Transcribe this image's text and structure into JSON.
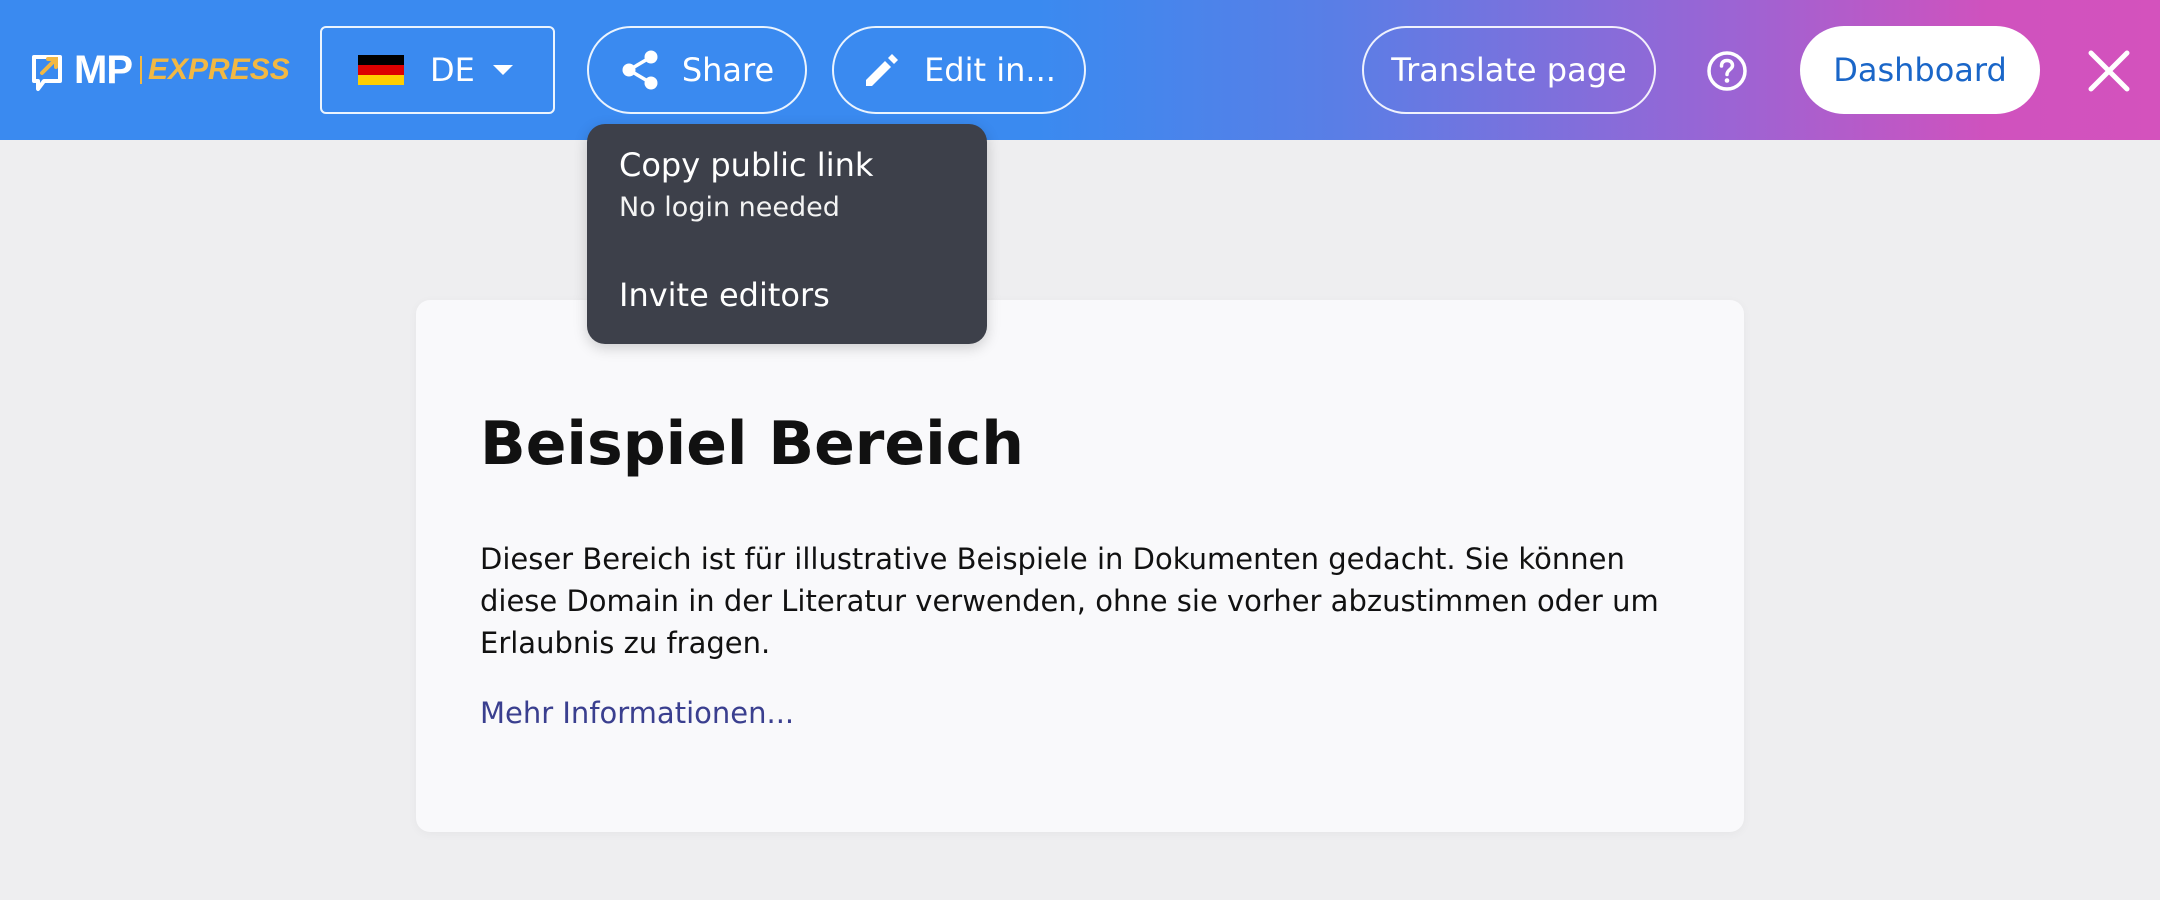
{
  "topbar": {
    "logo": {
      "mp": "MP",
      "express": "EXPRESS"
    },
    "language": {
      "code": "DE",
      "flag": "germany-flag"
    },
    "share_label": "Share",
    "edit_label": "Edit in...",
    "translate_label": "Translate page",
    "dashboard_label": "Dashboard",
    "icons": {
      "share": "share-icon",
      "edit": "pencil-icon",
      "help": "help-icon",
      "close": "close-icon"
    },
    "colors": {
      "gradient_start": "#3a8af0",
      "gradient_end": "#d452bd",
      "dashboard_text": "#1a66c8",
      "logo_accent": "#f2b843"
    }
  },
  "share_menu": {
    "items": [
      {
        "label": "Copy public link",
        "sublabel": "No login needed"
      },
      {
        "label": "Invite editors"
      }
    ],
    "background": "#3d404a"
  },
  "content": {
    "title": "Beispiel Bereich",
    "text": "Dieser Bereich ist für illustrative Beispiele in Dokumenten gedacht. Sie können diese Domain in der Literatur verwenden, ohne sie vorher abzustimmen oder um Erlaubnis zu fragen.",
    "link_label": "Mehr Informationen..."
  }
}
